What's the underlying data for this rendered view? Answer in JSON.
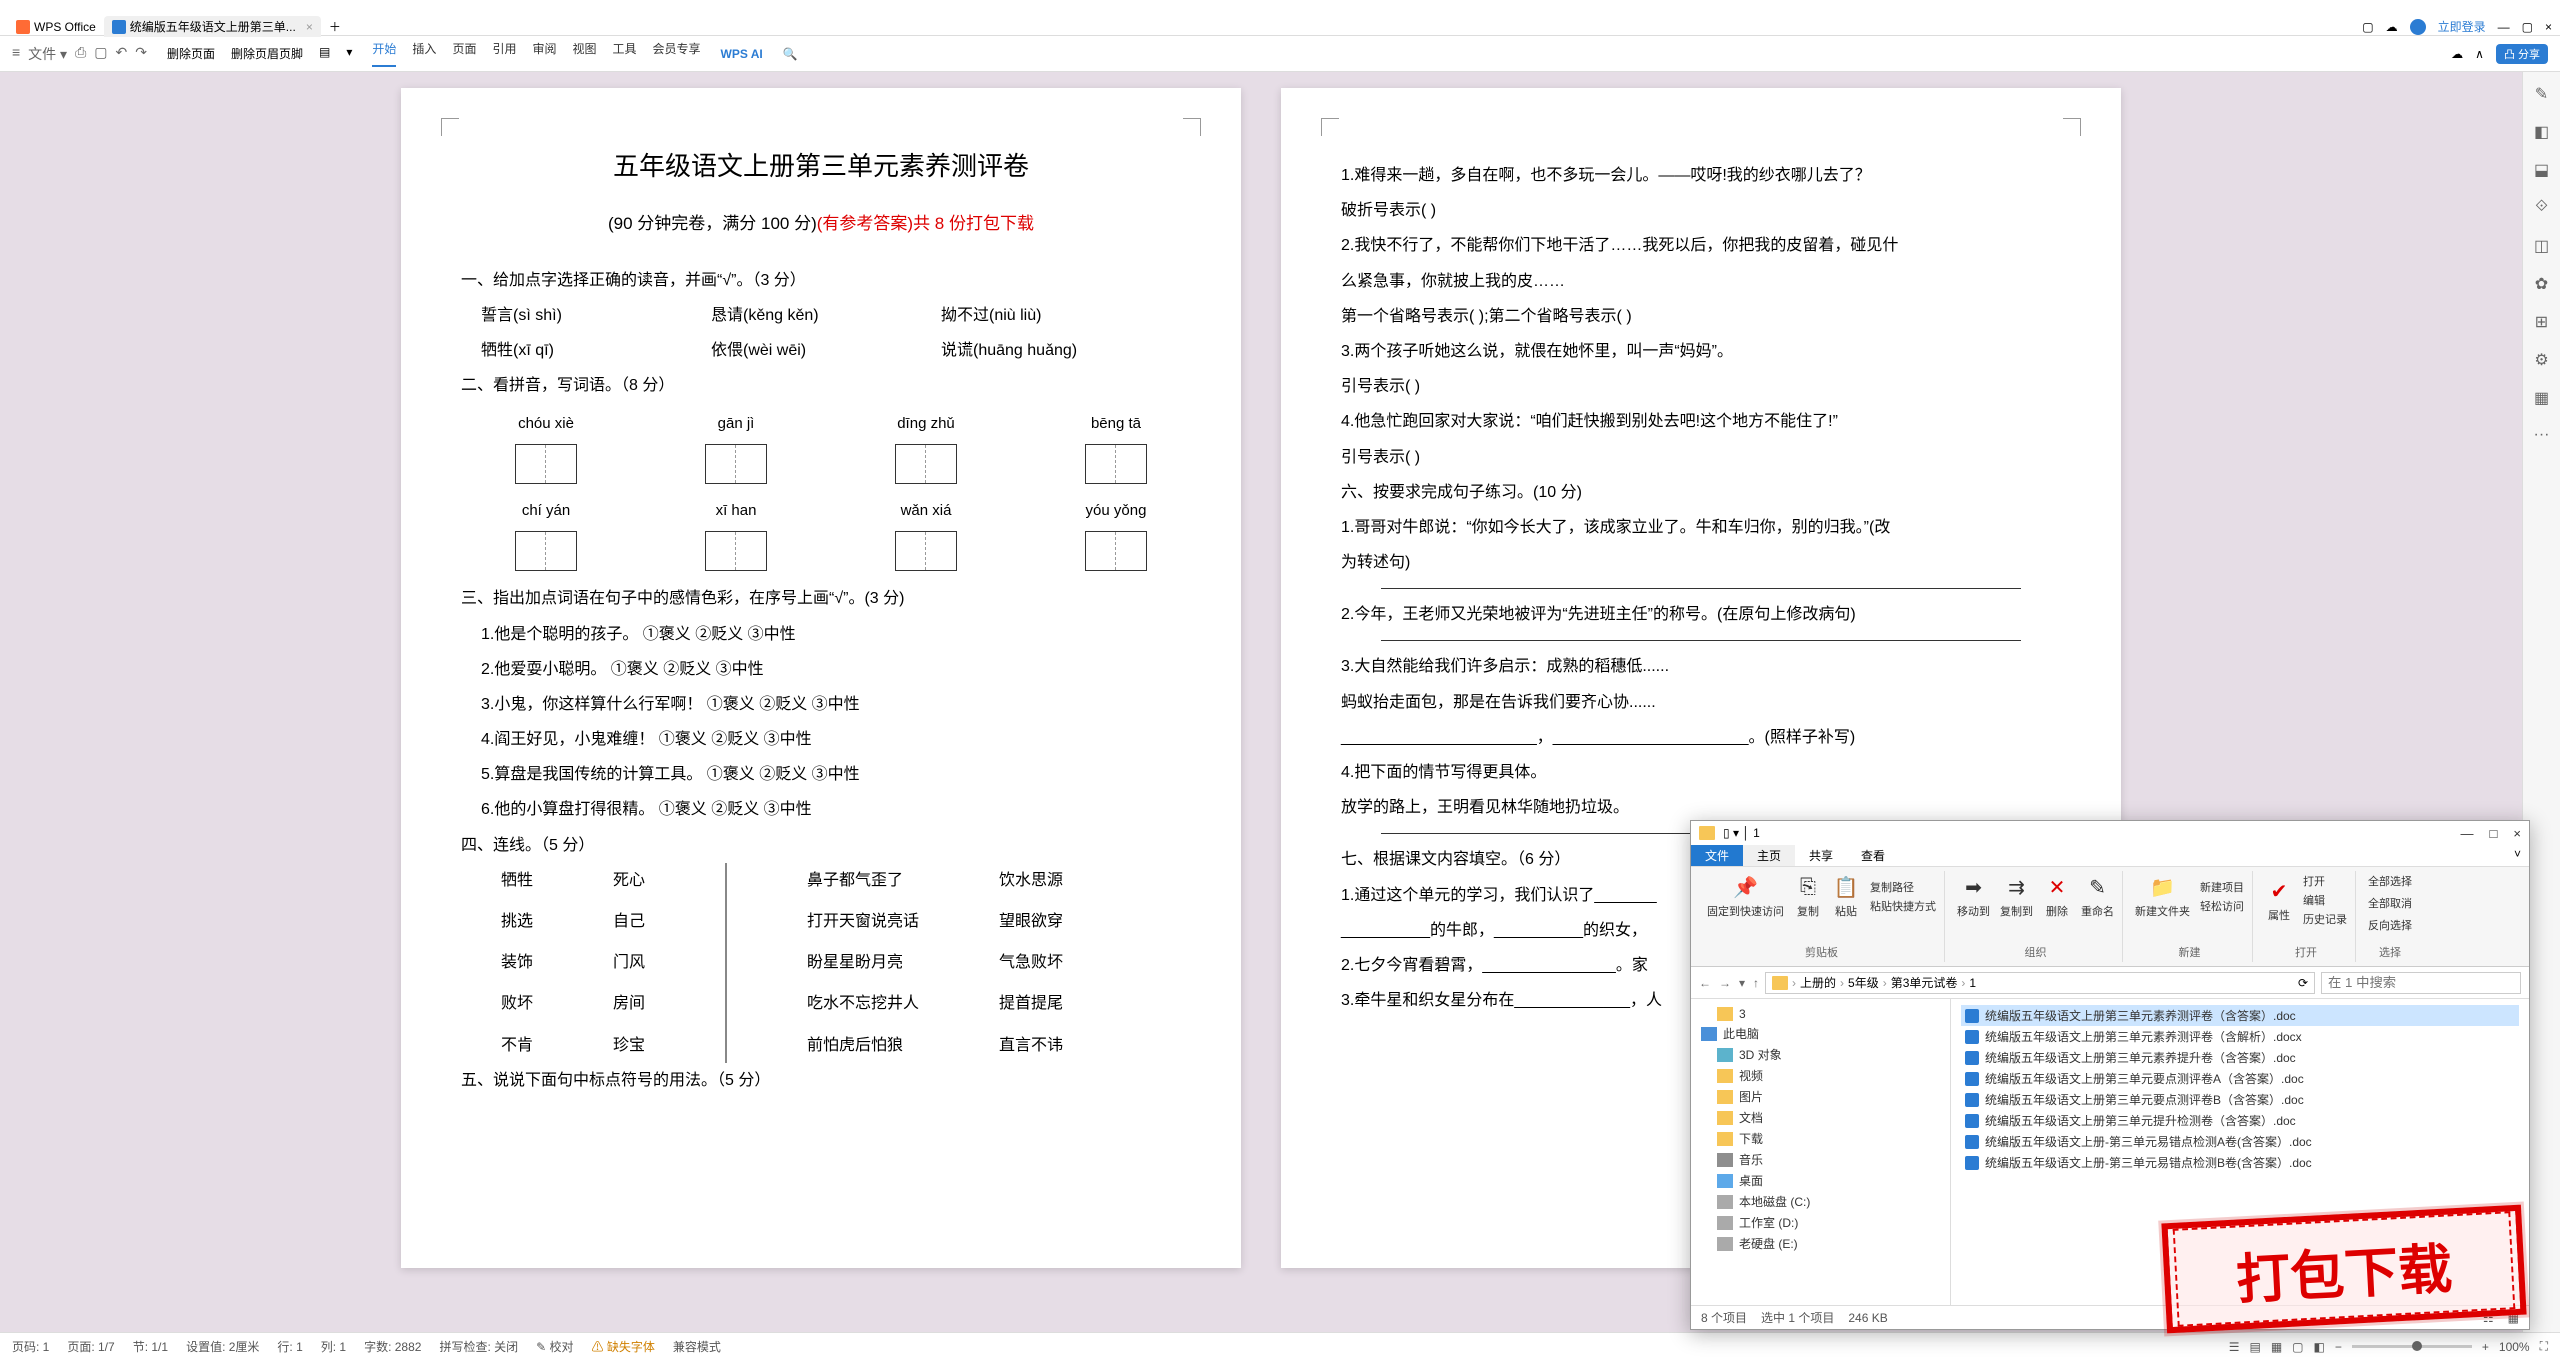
{
  "app": {
    "name": "WPS Office",
    "doc_tab": "统编版五年级语文上册第三单..."
  },
  "menubar": {
    "left_icons": [
      "≡",
      "文件",
      "⎙",
      "↶",
      "↷"
    ],
    "edit_group": [
      "删除页面",
      "删除页眉页脚"
    ],
    "tabs": [
      "开始",
      "插入",
      "页面",
      "引用",
      "审阅",
      "视图",
      "工具",
      "会员专享"
    ],
    "ai": "WPS AI",
    "login": "立即登录",
    "share": "分享"
  },
  "page1": {
    "title": "五年级语文上册第三单元素养测评卷",
    "subtitle_a": "(90 分钟完卷，满分 100 分)",
    "subtitle_b": "(有参考答案)共 8 份打包下载",
    "q1": "一、给加点字选择正确的读音，并画“√”。（3 分）",
    "r1": [
      "誓言(sì  shì)",
      "恳请(kěng  kěn)",
      "拗不过(niù  liù)"
    ],
    "r2": [
      "牺牲(xī  qī)",
      "依偎(wèi  wēi)",
      "说谎(huāng  huǎng)"
    ],
    "q2": "二、看拼音，写词语。（8 分）",
    "py1": [
      "chóu  xiè",
      "gān  jì",
      "dīng  zhǔ",
      "bēng  tā"
    ],
    "py2": [
      "chí  yán",
      "xī  han",
      "wǎn  xiá",
      "yóu  yǒng"
    ],
    "q3": "三、指出加点词语在句子中的感情色彩，在序号上画“√”。(3 分)",
    "q3_items": [
      "1.他是个聪明的孩子。        ①褒义    ②贬义    ③中性",
      "2.他爱耍小聪明。            ①褒义    ②贬义    ③中性",
      "3.小鬼，你这样算什么行军啊！        ①褒义    ②贬义    ③中性",
      "4.阎王好见，小鬼难缠！      ①褒义    ②贬义    ③中性",
      "5.算盘是我国传统的计算工具。        ①褒义    ②贬义    ③中性",
      "6.他的小算盘打得很精。      ①褒义    ②贬义    ③中性"
    ],
    "q4": "四、连线。（5 分）",
    "connect": {
      "c1": [
        "牺牲",
        "挑选",
        "装饰",
        "败坏",
        "不肯"
      ],
      "c2": [
        "死心",
        "自己",
        "门风",
        "房间",
        "珍宝"
      ],
      "c3": [
        "鼻子都气歪了",
        "打开天窗说亮话",
        "盼星星盼月亮",
        "吃水不忘挖井人",
        "前怕虎后怕狼"
      ],
      "c4": [
        "饮水思源",
        "望眼欲穿",
        "气急败坏",
        "提首提尾",
        "直言不讳"
      ]
    },
    "q5": "五、说说下面句中标点符号的用法。（5 分）"
  },
  "page2": {
    "l1": "1.难得来一趟，多自在啊，也不多玩一会儿。——哎呀!我的纱衣哪儿去了？",
    "l1b": "   破折号表示(                )",
    "l2": "2.我快不行了，不能帮你们下地干活了……我死以后，你把我的皮留着，碰见什",
    "l2b": "   么紧急事，你就披上我的皮……",
    "l2c": "   第一个省略号表示(              );第二个省略号表示(              )",
    "l3": "3.两个孩子听她这么说，就偎在她怀里，叫一声“妈妈”。",
    "l3b": "   引号表示(              )",
    "l4": "4.他急忙跑回家对大家说：“咱们赶快搬到别处去吧!这个地方不能住了!”",
    "l4b": "   引号表示(              )",
    "q6": "六、按要求完成句子练习。(10 分)",
    "l6a": "1.哥哥对牛郎说：“你如今长大了，该成家立业了。牛和车归你，别的归我。”(改",
    "l6b": "   为转述句)",
    "l7": "2.今年，王老师又光荣地被评为“先进班主任”的称号。(在原句上修改病句)",
    "l8": "3.大自然能给我们许多启示：成熟的稻穗低......",
    "l8b": "   蚂蚁抬走面包，那是在告诉我们要齐心协......",
    "l8c": "   ______________________，______________________。(照样子补写)",
    "l9": "4.把下面的情节写得更具体。",
    "l9b": "   放学的路上，王明看见林华随地扔垃圾。",
    "q7": "七、根据课文内容填空。（6 分）",
    "l10": "1.通过这个单元的学习，我们认识了_______",
    "l10b": "   __________的牛郎，__________的织女，",
    "l11": "2.七夕今宵看碧霄，_______________。家",
    "l12": "3.牵牛星和织女星分布在_____________，人"
  },
  "explorer": {
    "title_path": "1",
    "tabs": {
      "file": "文件",
      "home": "主页",
      "share": "共享",
      "view": "查看"
    },
    "ribbon": {
      "pin": "固定到快速访问",
      "copy": "复制",
      "paste": "粘贴",
      "copypath": "复制路径",
      "pasteshortcut": "粘贴快捷方式",
      "moveto": "移动到",
      "copyto": "复制到",
      "delete": "删除",
      "rename": "重命名",
      "newfolder": "新建文件夹",
      "newitem": "新建项目",
      "easyaccess": "轻松访问",
      "properties": "属性",
      "open": "打开",
      "edit": "编辑",
      "history": "历史记录",
      "selectall": "全部选择",
      "selectnone": "全部取消",
      "invertsel": "反向选择",
      "g_clip": "剪贴板",
      "g_org": "组织",
      "g_new": "新建",
      "g_open": "打开",
      "g_sel": "选择"
    },
    "breadcrumb": [
      "上册的",
      "5年级",
      "第3单元试卷",
      "1"
    ],
    "search_placeholder": "在 1 中搜索",
    "tree": [
      {
        "label": "3",
        "icon": "ti-folder",
        "indent": 1
      },
      {
        "label": "此电脑",
        "icon": "ti-pc",
        "indent": 0
      },
      {
        "label": "3D 对象",
        "icon": "ti-3d",
        "indent": 1
      },
      {
        "label": "视频",
        "icon": "ti-folder",
        "indent": 1
      },
      {
        "label": "图片",
        "icon": "ti-folder",
        "indent": 1
      },
      {
        "label": "文档",
        "icon": "ti-folder",
        "indent": 1
      },
      {
        "label": "下载",
        "icon": "ti-folder",
        "indent": 1
      },
      {
        "label": "音乐",
        "icon": "ti-music",
        "indent": 1
      },
      {
        "label": "桌面",
        "icon": "ti-desktop",
        "indent": 1
      },
      {
        "label": "本地磁盘 (C:)",
        "icon": "ti-drive",
        "indent": 1
      },
      {
        "label": "工作室 (D:)",
        "icon": "ti-drive",
        "indent": 1
      },
      {
        "label": "老硬盘 (E:)",
        "icon": "ti-drive",
        "indent": 1
      }
    ],
    "files": [
      {
        "name": "统编版五年级语文上册第三单元素养测评卷（含答案）.doc",
        "sel": true
      },
      {
        "name": "统编版五年级语文上册第三单元素养测评卷（含解析）.docx",
        "sel": false
      },
      {
        "name": "统编版五年级语文上册第三单元素养提升卷（含答案）.doc",
        "sel": false
      },
      {
        "name": "统编版五年级语文上册第三单元要点测评卷A（含答案）.doc",
        "sel": false
      },
      {
        "name": "统编版五年级语文上册第三单元要点测评卷B（含答案）.doc",
        "sel": false
      },
      {
        "name": "统编版五年级语文上册第三单元提升检测卷（含答案）.doc",
        "sel": false
      },
      {
        "name": "统编版五年级语文上册-第三单元易错点检测A卷(含答案）.doc",
        "sel": false
      },
      {
        "name": "统编版五年级语文上册-第三单元易错点检测B卷(含答案）.doc",
        "sel": false
      }
    ],
    "status": {
      "count": "8 个项目",
      "selected": "选中 1 个项目",
      "size": "246 KB"
    }
  },
  "stamp": "打包下载",
  "statusbar": {
    "page": "页码: 1",
    "pages": "页面: 1/7",
    "section": "节: 1/1",
    "setval": "设置值: 2厘米",
    "row": "行: 1",
    "col": "列: 1",
    "words": "字数: 2882",
    "spell": "拼写检查: 关闭",
    "proof": "校对",
    "missing": "缺失字体",
    "compat": "兼容模式",
    "zoom": "100%"
  },
  "sidebar_icons": [
    "✎",
    "◧",
    "⬓",
    "⟐",
    "◫",
    "✿",
    "⊞",
    "⚙",
    "▦",
    "···"
  ]
}
